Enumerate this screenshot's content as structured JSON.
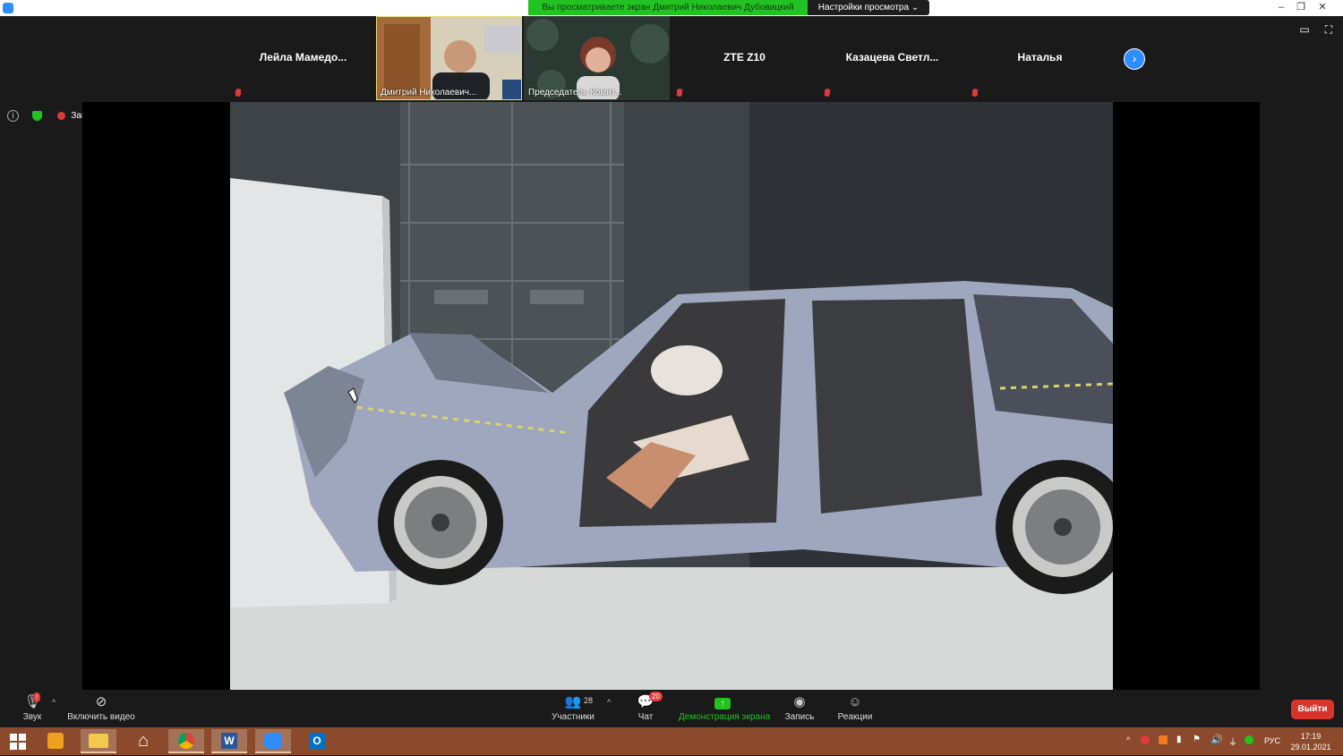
{
  "share_banner": {
    "text": "Вы просматриваете экран Дмитрий Николаевич Дубовицкий",
    "view_settings": "Настройки просмотра ⌄"
  },
  "window_controls": {
    "minimize": "–",
    "restore": "❐",
    "close": "✕"
  },
  "participants": [
    {
      "name": "Лейла  Мамедо...",
      "muted": true
    },
    {
      "caption": "Дмитрий Николаевич...",
      "video": true
    },
    {
      "caption": "Председатель Комит...",
      "video": true
    },
    {
      "name": "ZTE Z10",
      "muted": true
    },
    {
      "name": "Казацева  Светл...",
      "muted": true
    },
    {
      "name": "Наталья",
      "muted": true
    }
  ],
  "status": {
    "info": "i",
    "recording_label": "Запись"
  },
  "toolbar": {
    "audio": "Звук",
    "video": "Включить видео",
    "participants": "Участники",
    "participants_count": "28",
    "chat": "Чат",
    "chat_badge": "20",
    "share_screen": "Демонстрация экрана",
    "record": "Запись",
    "reactions": "Реакции",
    "leave": "Выйти"
  },
  "taskbar": {
    "language": "РУС",
    "time": "17:19",
    "date": "29.01.2021"
  },
  "colors": {
    "accent_blue": "#2d8cff",
    "banner_green": "#23c223",
    "leave_red": "#d9342b",
    "taskbar": "#8b4a2b"
  }
}
